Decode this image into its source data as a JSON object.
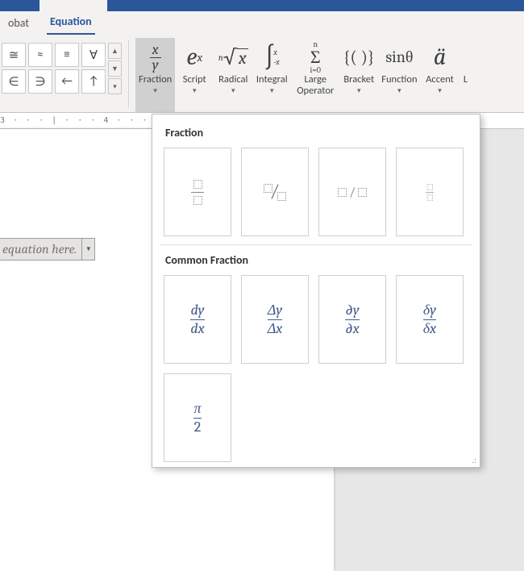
{
  "tabs": {
    "left": "obat",
    "active": "Equation"
  },
  "symbols": [
    "≅",
    "≈",
    "≡",
    "∀",
    "∈",
    "∋",
    "←",
    "↑"
  ],
  "structures": [
    {
      "name": "fraction",
      "label": "Fraction",
      "twoLine": false
    },
    {
      "name": "script",
      "label": "Script",
      "twoLine": false
    },
    {
      "name": "radical",
      "label": "Radical",
      "twoLine": false
    },
    {
      "name": "integral",
      "label": "Integral",
      "twoLine": false
    },
    {
      "name": "large-operator",
      "label": "Large\nOperator",
      "twoLine": true
    },
    {
      "name": "bracket",
      "label": "Bracket",
      "twoLine": false
    },
    {
      "name": "function",
      "label": "Function",
      "twoLine": false
    },
    {
      "name": "accent",
      "label": "Accent",
      "twoLine": false
    },
    {
      "name": "limit",
      "label": "L",
      "twoLine": false
    }
  ],
  "ruler_text": "3 · · · | · · · 4 · · · | ·",
  "equation_placeholder": "equation here.",
  "gallery": {
    "sections": {
      "fraction": "Fraction",
      "common": "Common Fraction"
    },
    "common": [
      {
        "num": "dy",
        "den": "dx"
      },
      {
        "num": "Δy",
        "den": "Δx"
      },
      {
        "num": "∂y",
        "den": "∂x"
      },
      {
        "num": "δy",
        "den": "δx"
      },
      {
        "num": "π",
        "den": "2"
      }
    ],
    "resize_glyph": ".:"
  }
}
